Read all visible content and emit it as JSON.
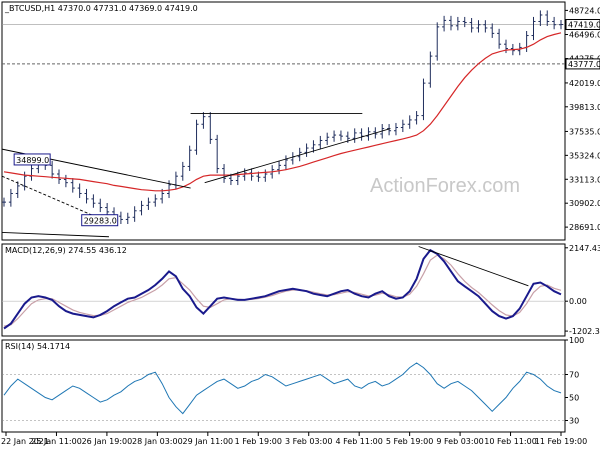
{
  "watermark": "ActionForex.com",
  "chart_data": [
    {
      "type": "candlestick",
      "title": "_BTCUSD,H1  47370.0 47731.0 47369.0 47419.0",
      "ylim": [
        27500,
        49500
      ],
      "y_ticks": [
        "48724.0",
        "46496.0",
        "44275.0",
        "42019.0",
        "39813.0",
        "37535.0",
        "35324.0",
        "33113.0",
        "30902.0",
        "28691.0"
      ],
      "y_tick_values": [
        48724,
        46496,
        44275,
        42019,
        39813,
        37535,
        35324,
        33113,
        30902,
        28691
      ],
      "current_price_label": "47419.0",
      "current_price": 47419,
      "level_label": "43777.0",
      "level": 43777,
      "annotations": [
        {
          "text": "34899.0",
          "x": 0.05,
          "y": 34899
        },
        {
          "text": "29283.0",
          "x": 0.17,
          "y": 29283
        }
      ],
      "close": [
        31000,
        31800,
        32500,
        33400,
        34100,
        34700,
        34400,
        33600,
        33100,
        32800,
        32300,
        31800,
        31300,
        30900,
        30500,
        30100,
        29700,
        29400,
        29600,
        30200,
        30700,
        31000,
        31300,
        31800,
        32600,
        33400,
        34300,
        35800,
        38200,
        38900,
        36800,
        34100,
        33200,
        33000,
        33400,
        33700,
        33400,
        33300,
        33600,
        34000,
        34400,
        34900,
        35200,
        35600,
        36000,
        36300,
        36700,
        37000,
        37200,
        37100,
        36900,
        37400,
        37100,
        37500,
        37300,
        37800,
        37600,
        37900,
        38200,
        38600,
        39000,
        42000,
        44500,
        47200,
        47800,
        47300,
        47700,
        47600,
        47100,
        47400,
        47100,
        46600,
        45600,
        45200,
        45000,
        45300,
        46400,
        47700,
        48300,
        47700,
        47400,
        47419
      ],
      "sma": [
        33800,
        33700,
        33600,
        33500,
        33450,
        33400,
        33350,
        33300,
        33250,
        33200,
        33150,
        33100,
        33000,
        32900,
        32800,
        32700,
        32550,
        32450,
        32350,
        32250,
        32150,
        32100,
        32050,
        32050,
        32100,
        32200,
        32400,
        32700,
        33100,
        33400,
        33500,
        33500,
        33500,
        33500,
        33550,
        33600,
        33650,
        33700,
        33750,
        33800,
        33900,
        34000,
        34150,
        34300,
        34500,
        34700,
        34900,
        35100,
        35300,
        35500,
        35650,
        35800,
        35950,
        36100,
        36250,
        36400,
        36550,
        36700,
        36850,
        37000,
        37200,
        37600,
        38200,
        39000,
        39900,
        40800,
        41700,
        42500,
        43200,
        43800,
        44300,
        44700,
        44900,
        45050,
        45100,
        45150,
        45300,
        45600,
        46000,
        46300,
        46500,
        46650
      ],
      "trendlines": [
        {
          "x": [
            0.0,
            0.335
          ],
          "y": [
            35900,
            32300
          ]
        },
        {
          "x": [
            0.0,
            0.2
          ],
          "y": [
            33400,
            28900
          ]
        },
        {
          "x": [
            0.36,
            0.69
          ],
          "y": [
            32800,
            37800
          ]
        },
        {
          "x": [
            0.335,
            0.64
          ],
          "y": [
            39200,
            39200
          ]
        },
        {
          "x": [
            0.0,
            0.19
          ],
          "y": [
            28200,
            27800
          ]
        }
      ],
      "x_tick_labels": [
        "22 Jan 2021",
        "25 Jan 11:00",
        "26 Jan 19:00",
        "28 Jan 03:00",
        "29 Jan 11:00",
        "1 Feb 19:00",
        "3 Feb 03:00",
        "4 Feb 11:00",
        "5 Feb 19:00",
        "9 Feb 03:00",
        "10 Feb 11:00",
        "11 Feb 19:00"
      ],
      "colors": {
        "candle": "#1f2d5c",
        "sma": "#d62728",
        "frame": "#000000"
      }
    },
    {
      "type": "line",
      "title": "MACD(12,26,9) 274.55 436.12",
      "ylim": [
        -1400,
        2300
      ],
      "y_ticks": [
        "2147.43",
        "0.00",
        "-1202.34"
      ],
      "y_tick_values": [
        2147.43,
        0,
        -1202.34
      ],
      "series": [
        {
          "name": "MACD",
          "color": "#1a1a8c",
          "values": [
            -1100,
            -900,
            -500,
            -100,
            150,
            200,
            150,
            50,
            -200,
            -400,
            -500,
            -550,
            -600,
            -650,
            -550,
            -400,
            -200,
            -50,
            100,
            150,
            300,
            450,
            650,
            900,
            1200,
            1000,
            500,
            200,
            -250,
            -500,
            -200,
            100,
            150,
            100,
            50,
            50,
            100,
            150,
            200,
            300,
            400,
            450,
            500,
            450,
            400,
            300,
            250,
            200,
            300,
            400,
            450,
            300,
            200,
            150,
            300,
            400,
            200,
            100,
            150,
            400,
            900,
            1700,
            2050,
            1900,
            1600,
            1200,
            800,
            600,
            400,
            200,
            -100,
            -400,
            -600,
            -700,
            -600,
            -300,
            200,
            700,
            750,
            600,
            400,
            274
          ]
        },
        {
          "name": "Signal",
          "color": "#c8a0a8",
          "values": [
            -1000,
            -950,
            -700,
            -400,
            -100,
            50,
            100,
            100,
            -50,
            -200,
            -350,
            -450,
            -520,
            -580,
            -570,
            -500,
            -350,
            -200,
            -50,
            50,
            150,
            300,
            450,
            650,
            900,
            950,
            700,
            450,
            100,
            -200,
            -250,
            -100,
            50,
            100,
            80,
            60,
            70,
            110,
            160,
            230,
            320,
            400,
            450,
            450,
            420,
            360,
            300,
            250,
            260,
            320,
            380,
            350,
            280,
            210,
            240,
            320,
            260,
            180,
            160,
            280,
            600,
            1100,
            1650,
            1850,
            1700,
            1450,
            1100,
            800,
            550,
            350,
            100,
            -150,
            -380,
            -550,
            -600,
            -450,
            -100,
            350,
            600,
            650,
            520,
            436
          ]
        }
      ],
      "trendline": {
        "x": [
          0.74,
          0.935
        ],
        "y": [
          2200,
          620
        ]
      },
      "colors": {
        "frame": "#000000"
      }
    },
    {
      "type": "line",
      "title": "RSI(14) 54.1714",
      "ylim": [
        20,
        100
      ],
      "y_ticks": [
        "100",
        "70",
        "50",
        "30"
      ],
      "y_tick_values": [
        100,
        70,
        50,
        30
      ],
      "series": [
        {
          "name": "RSI",
          "color": "#1f77b4",
          "values": [
            52,
            60,
            66,
            62,
            58,
            54,
            50,
            48,
            52,
            56,
            60,
            58,
            54,
            50,
            46,
            48,
            52,
            55,
            60,
            64,
            66,
            70,
            72,
            62,
            50,
            42,
            36,
            44,
            52,
            56,
            60,
            64,
            66,
            62,
            58,
            60,
            64,
            66,
            70,
            68,
            64,
            60,
            62,
            64,
            66,
            68,
            70,
            66,
            62,
            64,
            66,
            60,
            58,
            62,
            64,
            60,
            62,
            66,
            70,
            76,
            80,
            76,
            70,
            62,
            58,
            62,
            64,
            60,
            56,
            50,
            44,
            38,
            44,
            50,
            58,
            64,
            72,
            70,
            66,
            60,
            56,
            54
          ]
        }
      ],
      "colors": {
        "frame": "#000000"
      }
    }
  ]
}
